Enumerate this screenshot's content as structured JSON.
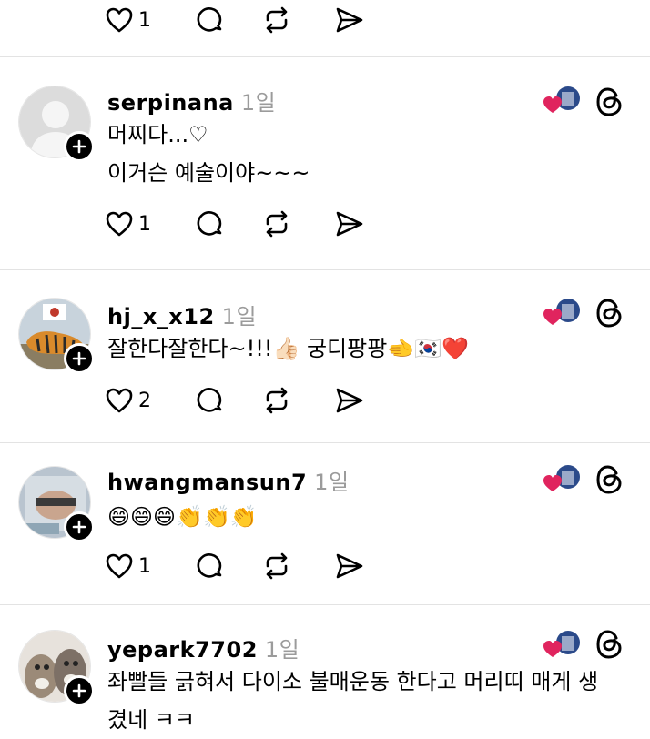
{
  "top_actions": {
    "like_count": "1"
  },
  "posts": [
    {
      "username": "serpinana",
      "time": "1일",
      "text": "머찌다...♡\n이거슨 예술이야~~~",
      "like_count": "1"
    },
    {
      "username": "hj_x_x12",
      "time": "1일",
      "text": "잘한다잘한다~!!!👍🏻 궁디팡팡🫲🇰🇷❤️",
      "like_count": "2"
    },
    {
      "username": "hwangmansun7",
      "time": "1일",
      "text": "😄😄😄👏👏👏",
      "like_count": "1"
    },
    {
      "username": "yepark7702",
      "time": "1일",
      "text": "좌빨들 긁혀서 다이소 불매운동 한다고 머리띠 매게 생\n겼네 ㅋㅋ",
      "like_count": ""
    }
  ],
  "colors": {
    "heart": "#e0245e",
    "muted": "#9b9b9b",
    "divider": "#e3e3e3"
  },
  "icons": [
    "heart-outline-icon",
    "comment-icon",
    "repost-icon",
    "share-icon",
    "threads-logo-icon",
    "plus-icon"
  ]
}
